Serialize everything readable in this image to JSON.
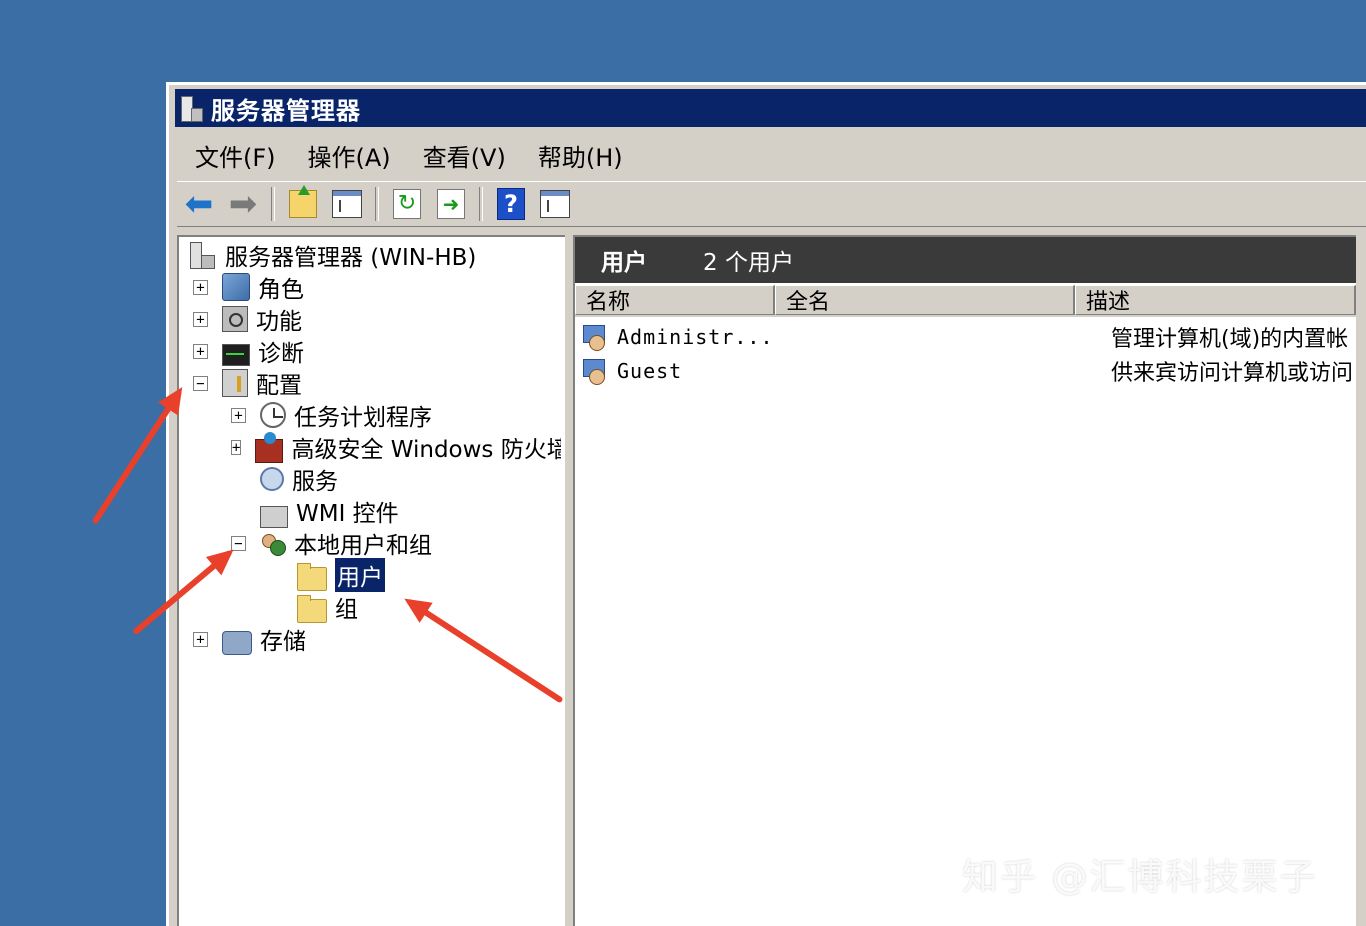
{
  "window": {
    "title": "服务器管理器"
  },
  "menu": [
    "文件(F)",
    "操作(A)",
    "查看(V)",
    "帮助(H)"
  ],
  "tree": {
    "root": "服务器管理器 (WIN-HB)",
    "roles": "角色",
    "features": "功能",
    "diagnostics": "诊断",
    "configuration": "配置",
    "task_scheduler": "任务计划程序",
    "firewall": "高级安全 Windows 防火墙",
    "services": "服务",
    "wmi": "WMI 控件",
    "local_users_groups": "本地用户和组",
    "users": "用户",
    "groups": "组",
    "storage": "存储",
    "expand_symbol": "+",
    "collapse_symbol": "−"
  },
  "content": {
    "title": "用户",
    "count": "2 个用户",
    "columns": [
      "名称",
      "全名",
      "描述"
    ],
    "rows": [
      {
        "name": "Administr...",
        "fullname": "",
        "description": "管理计算机(域)的内置帐"
      },
      {
        "name": "Guest",
        "fullname": "",
        "description": "供来宾访问计算机或访问"
      }
    ]
  },
  "watermark": "知乎 @汇博科技栗子",
  "colors": {
    "desktop": "#3a6ea5",
    "titlebar": "#0a246a",
    "arrow": "#e8402a",
    "header_band": "#3a3a3a"
  }
}
